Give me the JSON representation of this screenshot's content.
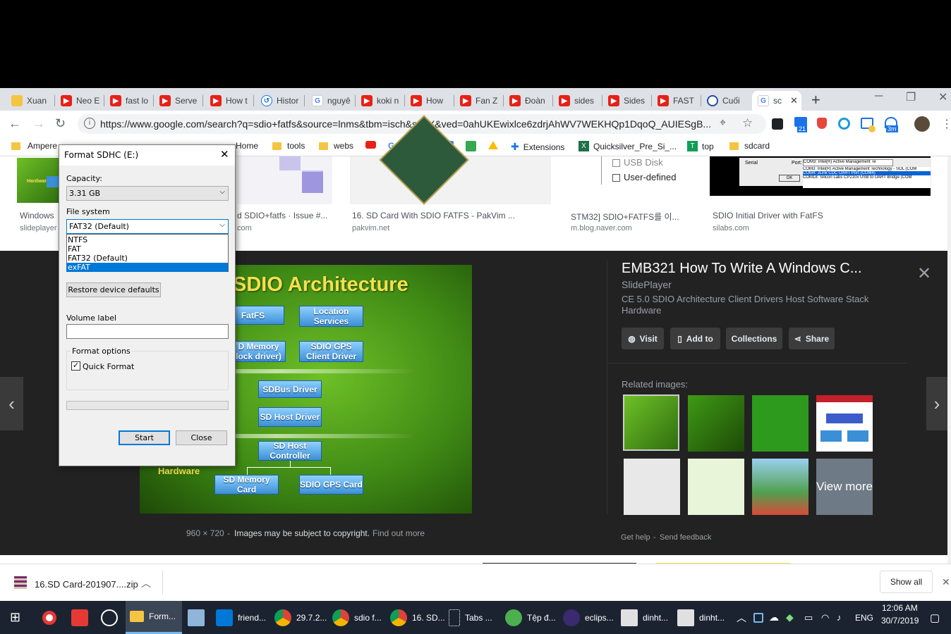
{
  "tabs": [
    {
      "label": "Xuan",
      "icon": "folder-icon"
    },
    {
      "label": "Neo E",
      "icon": "youtube-icon"
    },
    {
      "label": "fast lo",
      "icon": "youtube-icon"
    },
    {
      "label": "Serve",
      "icon": "youtube-icon"
    },
    {
      "label": "How t",
      "icon": "youtube-icon"
    },
    {
      "label": "Histor",
      "icon": "history-icon"
    },
    {
      "label": "nguyê",
      "icon": "google-icon"
    },
    {
      "label": "koki n",
      "icon": "youtube-icon"
    },
    {
      "label": "How",
      "icon": "youtube-icon"
    },
    {
      "label": "Fan Z",
      "icon": "youtube-icon"
    },
    {
      "label": "Đoàn",
      "icon": "youtube-icon"
    },
    {
      "label": "sides",
      "icon": "youtube-icon"
    },
    {
      "label": "Sides",
      "icon": "youtube-icon"
    },
    {
      "label": "FAST",
      "icon": "youtube-icon"
    },
    {
      "label": "Cuối",
      "icon": "vietcombank-icon"
    },
    {
      "label": "sc",
      "icon": "google-icon"
    }
  ],
  "address": {
    "url": "https://www.google.com/search?q=sdio+fatfs&source=lnms&tbm=isch&sa=X&ved=0ahUKEwixlce6zdrjAhWV7WEKHQp1DqoQ_AUIESgB..."
  },
  "extensions": {
    "badge_21": "21",
    "badge_3m": "3m"
  },
  "bookmarks": [
    "Ampere",
    "Home",
    "tools",
    "webs",
    "n",
    "Extensions",
    "Quicksilver_Pre_Si_...",
    "top",
    "sdcard"
  ],
  "results": [
    {
      "caption": "Windows",
      "source": "slideplayer"
    },
    {
      "caption": "d SDIO+fatfs · Issue #...",
      "source": "com"
    },
    {
      "caption": "16. SD Card With SDIO FATFS - PakVim ...",
      "source": "pakvim.net"
    },
    {
      "caption": "STM32] SDIO+FATFS를 이...",
      "source": "m.blog.naver.com"
    },
    {
      "caption": "SDIO Initial Driver with FatFS",
      "source": "silabs.com"
    }
  ],
  "thumb_text": {
    "hardware": "Hardware",
    "usb_disk": "USB Disk",
    "user_defined": "User-defined",
    "serial": "Serial",
    "port": "Port:",
    "port_value": "COM3: Intel(R) Active Management Te",
    "ok": "OK",
    "com_list": [
      "COM3: Intel(R) Active Management Technology - SOL (COM",
      "COM4: JLink CDC UART Port (COM4)",
      "COM18: Silicon Labs CP210x USB to UART Bridge (COM"
    ]
  },
  "preview": {
    "title": "EMB321 How To Write A Windows C...",
    "site": "SlidePlayer",
    "description": "CE 5.0 SDIO Architecture Client Drivers Host Software Stack Hardware",
    "buttons": [
      "Visit",
      "Add to",
      "Collections",
      "Share"
    ],
    "related_label": "Related images:",
    "view_more": "View more",
    "dimensions": "960 × 720",
    "copyright": "Images may be subject to copyright.",
    "find_out_more": "Find out more",
    "get_help": "Get help",
    "send_feedback": "Send feedback"
  },
  "diagram": {
    "title": "SDIO Architecture",
    "boxes": [
      "FatFS",
      "Location Services",
      "D Memory lock driver)",
      "SDIO GPS Client Driver",
      "SDBus Driver",
      "SD Host Driver",
      "SD Host Controller",
      "SD Memory Card",
      "SDIO GPS Card"
    ],
    "side_label": "Hardware"
  },
  "dialog": {
    "title": "Format SDHC (E:)",
    "capacity_label": "Capacity:",
    "capacity_value": "3.31 GB",
    "fs_label": "File system",
    "fs_value": "FAT32 (Default)",
    "fs_options": [
      "NTFS",
      "FAT",
      "FAT32 (Default)",
      "exFAT"
    ],
    "fs_highlighted": "exFAT",
    "restore_button": "Restore device defaults",
    "volume_label": "Volume label",
    "volume_value": "",
    "format_options": "Format options",
    "quick_format": "Quick Format",
    "quick_format_checked": true,
    "start": "Start",
    "close": "Close"
  },
  "download": {
    "file": "16.SD Card-201907....zip",
    "show_all": "Show all"
  },
  "taskbar": {
    "items": [
      "Form...",
      "friend...",
      "29.7.2...",
      "sdio f...",
      "16. SD...",
      "Tabs ...",
      "Tệp đ...",
      "eclips...",
      "dinht...",
      "dinht..."
    ],
    "lang": "ENG",
    "time": "12:06 AM",
    "date": "30/7/2019"
  },
  "colors": {
    "accent": "#0078d7",
    "chrome_bg": "#dee1e6",
    "viewer_bg": "#222222",
    "taskbar": "#1b2331"
  }
}
